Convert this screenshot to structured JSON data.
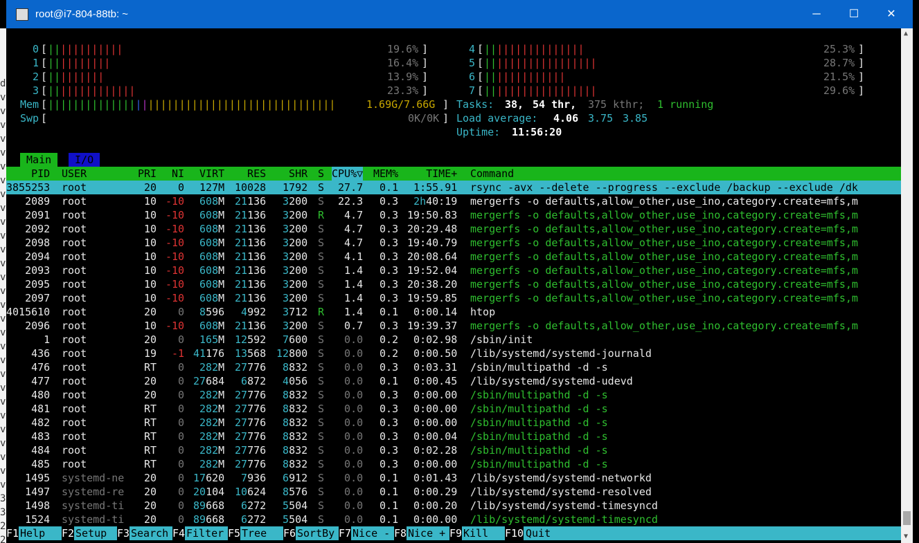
{
  "window": {
    "title": "root@i7-804-88tb: ~"
  },
  "left_strip": [
    "d",
    "v",
    "v",
    "v",
    "v",
    "v",
    "v",
    "v",
    "v",
    "v",
    "v",
    "v",
    "v",
    "v",
    "v",
    "v",
    "v",
    "v",
    "v",
    "v",
    "v",
    "v",
    "v",
    "v",
    "v",
    "v",
    "v",
    "v",
    "v",
    "v",
    "3",
    "3",
    "2",
    "2",
    "2"
  ],
  "cpus": [
    {
      "id": "0",
      "pct": "19.6%",
      "bars": 12
    },
    {
      "id": "1",
      "pct": "16.4%",
      "bars": 10
    },
    {
      "id": "2",
      "pct": "13.9%",
      "bars": 9
    },
    {
      "id": "3",
      "pct": "23.3%",
      "bars": 14
    },
    {
      "id": "4",
      "pct": "25.3%",
      "bars": 16
    },
    {
      "id": "5",
      "pct": "28.7%",
      "bars": 18
    },
    {
      "id": "6",
      "pct": "21.5%",
      "bars": 13
    },
    {
      "id": "7",
      "pct": "29.6%",
      "bars": 18
    }
  ],
  "mem": {
    "label": "Mem",
    "value": "1.69G/7.66G"
  },
  "swp": {
    "label": "Swp",
    "value": "0K/0K"
  },
  "tasks": {
    "label": "Tasks:",
    "count": "38,",
    "thr": "54 thr,",
    "kthr": "375 kthr;",
    "running": "1 running"
  },
  "load": {
    "label": "Load average:",
    "v1": "4.06",
    "v2": "3.75",
    "v3": "3.85"
  },
  "uptime": {
    "label": "Uptime:",
    "value": "11:56:20"
  },
  "tabs": [
    "Main",
    "I/O"
  ],
  "columns": [
    "PID",
    "USER",
    "PRI",
    "NI",
    "VIRT",
    "RES",
    "SHR",
    "S",
    "CPU%▽",
    "MEM%",
    "TIME+",
    "Command"
  ],
  "processes": [
    {
      "pid": "3855253",
      "user": "root",
      "pri": "20",
      "ni": "0",
      "virt": "127M",
      "res": "10028",
      "shr": "1792",
      "s": "S",
      "cpu": "27.7",
      "mem": "0.1",
      "time": "1:55.91",
      "cmd": "rsync -avx --delete --progress --exclude /backup --exclude /dk",
      "selected": true
    },
    {
      "pid": "2089",
      "user": "root",
      "pri": "10",
      "ni": "-10",
      "virt": "608M",
      "res": "21136",
      "shr": "3200",
      "s": "S",
      "cpu": "22.3",
      "mem": "0.3",
      "time": "2h40:19",
      "cmd": "mergerfs -o defaults,allow_other,use_ino,category.create=mfs,m",
      "thread": false
    },
    {
      "pid": "2091",
      "user": "root",
      "pri": "10",
      "ni": "-10",
      "virt": "608M",
      "res": "21136",
      "shr": "3200",
      "s": "R",
      "cpu": "4.7",
      "mem": "0.3",
      "time": "19:50.83",
      "cmd": "mergerfs -o defaults,allow_other,use_ino,category.create=mfs,m",
      "thread": true
    },
    {
      "pid": "2092",
      "user": "root",
      "pri": "10",
      "ni": "-10",
      "virt": "608M",
      "res": "21136",
      "shr": "3200",
      "s": "S",
      "cpu": "4.7",
      "mem": "0.3",
      "time": "20:29.48",
      "cmd": "mergerfs -o defaults,allow_other,use_ino,category.create=mfs,m",
      "thread": true
    },
    {
      "pid": "2098",
      "user": "root",
      "pri": "10",
      "ni": "-10",
      "virt": "608M",
      "res": "21136",
      "shr": "3200",
      "s": "S",
      "cpu": "4.7",
      "mem": "0.3",
      "time": "19:40.79",
      "cmd": "mergerfs -o defaults,allow_other,use_ino,category.create=mfs,m",
      "thread": true
    },
    {
      "pid": "2094",
      "user": "root",
      "pri": "10",
      "ni": "-10",
      "virt": "608M",
      "res": "21136",
      "shr": "3200",
      "s": "S",
      "cpu": "4.1",
      "mem": "0.3",
      "time": "20:08.64",
      "cmd": "mergerfs -o defaults,allow_other,use_ino,category.create=mfs,m",
      "thread": true
    },
    {
      "pid": "2093",
      "user": "root",
      "pri": "10",
      "ni": "-10",
      "virt": "608M",
      "res": "21136",
      "shr": "3200",
      "s": "S",
      "cpu": "1.4",
      "mem": "0.3",
      "time": "19:52.04",
      "cmd": "mergerfs -o defaults,allow_other,use_ino,category.create=mfs,m",
      "thread": true
    },
    {
      "pid": "2095",
      "user": "root",
      "pri": "10",
      "ni": "-10",
      "virt": "608M",
      "res": "21136",
      "shr": "3200",
      "s": "S",
      "cpu": "1.4",
      "mem": "0.3",
      "time": "20:38.20",
      "cmd": "mergerfs -o defaults,allow_other,use_ino,category.create=mfs,m",
      "thread": true
    },
    {
      "pid": "2097",
      "user": "root",
      "pri": "10",
      "ni": "-10",
      "virt": "608M",
      "res": "21136",
      "shr": "3200",
      "s": "S",
      "cpu": "1.4",
      "mem": "0.3",
      "time": "19:59.85",
      "cmd": "mergerfs -o defaults,allow_other,use_ino,category.create=mfs,m",
      "thread": true
    },
    {
      "pid": "4015610",
      "user": "root",
      "pri": "20",
      "ni": "0",
      "virt": "8596",
      "res": "4992",
      "shr": "3712",
      "s": "R",
      "cpu": "1.4",
      "mem": "0.1",
      "time": "0:00.14",
      "cmd": "htop",
      "thread": false
    },
    {
      "pid": "2096",
      "user": "root",
      "pri": "10",
      "ni": "-10",
      "virt": "608M",
      "res": "21136",
      "shr": "3200",
      "s": "S",
      "cpu": "0.7",
      "mem": "0.3",
      "time": "19:39.37",
      "cmd": "mergerfs -o defaults,allow_other,use_ino,category.create=mfs,m",
      "thread": true
    },
    {
      "pid": "1",
      "user": "root",
      "pri": "20",
      "ni": "0",
      "virt": "165M",
      "res": "12592",
      "shr": "7600",
      "s": "S",
      "cpu": "0.0",
      "mem": "0.2",
      "time": "0:02.98",
      "cmd": "/sbin/init",
      "thread": false
    },
    {
      "pid": "436",
      "user": "root",
      "pri": "19",
      "ni": "-1",
      "virt": "41176",
      "res": "13568",
      "shr": "12800",
      "s": "S",
      "cpu": "0.0",
      "mem": "0.2",
      "time": "0:00.50",
      "cmd": "/lib/systemd/systemd-journald",
      "thread": false
    },
    {
      "pid": "476",
      "user": "root",
      "pri": "RT",
      "ni": "0",
      "virt": "282M",
      "res": "27776",
      "shr": "8832",
      "s": "S",
      "cpu": "0.0",
      "mem": "0.3",
      "time": "0:03.31",
      "cmd": "/sbin/multipathd -d -s",
      "thread": false
    },
    {
      "pid": "477",
      "user": "root",
      "pri": "20",
      "ni": "0",
      "virt": "27684",
      "res": "6872",
      "shr": "4056",
      "s": "S",
      "cpu": "0.0",
      "mem": "0.1",
      "time": "0:00.45",
      "cmd": "/lib/systemd/systemd-udevd",
      "thread": false
    },
    {
      "pid": "480",
      "user": "root",
      "pri": "20",
      "ni": "0",
      "virt": "282M",
      "res": "27776",
      "shr": "8832",
      "s": "S",
      "cpu": "0.0",
      "mem": "0.3",
      "time": "0:00.00",
      "cmd": "/sbin/multipathd -d -s",
      "thread": true
    },
    {
      "pid": "481",
      "user": "root",
      "pri": "RT",
      "ni": "0",
      "virt": "282M",
      "res": "27776",
      "shr": "8832",
      "s": "S",
      "cpu": "0.0",
      "mem": "0.3",
      "time": "0:00.00",
      "cmd": "/sbin/multipathd -d -s",
      "thread": true
    },
    {
      "pid": "482",
      "user": "root",
      "pri": "RT",
      "ni": "0",
      "virt": "282M",
      "res": "27776",
      "shr": "8832",
      "s": "S",
      "cpu": "0.0",
      "mem": "0.3",
      "time": "0:00.00",
      "cmd": "/sbin/multipathd -d -s",
      "thread": true
    },
    {
      "pid": "483",
      "user": "root",
      "pri": "RT",
      "ni": "0",
      "virt": "282M",
      "res": "27776",
      "shr": "8832",
      "s": "S",
      "cpu": "0.0",
      "mem": "0.3",
      "time": "0:00.04",
      "cmd": "/sbin/multipathd -d -s",
      "thread": true
    },
    {
      "pid": "484",
      "user": "root",
      "pri": "RT",
      "ni": "0",
      "virt": "282M",
      "res": "27776",
      "shr": "8832",
      "s": "S",
      "cpu": "0.0",
      "mem": "0.3",
      "time": "0:02.28",
      "cmd": "/sbin/multipathd -d -s",
      "thread": true
    },
    {
      "pid": "485",
      "user": "root",
      "pri": "RT",
      "ni": "0",
      "virt": "282M",
      "res": "27776",
      "shr": "8832",
      "s": "S",
      "cpu": "0.0",
      "mem": "0.3",
      "time": "0:00.00",
      "cmd": "/sbin/multipathd -d -s",
      "thread": true
    },
    {
      "pid": "1495",
      "user": "systemd-ne",
      "pri": "20",
      "ni": "0",
      "virt": "17620",
      "res": "7936",
      "shr": "6912",
      "s": "S",
      "cpu": "0.0",
      "mem": "0.1",
      "time": "0:01.43",
      "cmd": "/lib/systemd/systemd-networkd",
      "thread": false
    },
    {
      "pid": "1497",
      "user": "systemd-re",
      "pri": "20",
      "ni": "0",
      "virt": "20104",
      "res": "10624",
      "shr": "8576",
      "s": "S",
      "cpu": "0.0",
      "mem": "0.1",
      "time": "0:00.29",
      "cmd": "/lib/systemd/systemd-resolved",
      "thread": false
    },
    {
      "pid": "1498",
      "user": "systemd-ti",
      "pri": "20",
      "ni": "0",
      "virt": "89668",
      "res": "6272",
      "shr": "5504",
      "s": "S",
      "cpu": "0.0",
      "mem": "0.1",
      "time": "0:00.20",
      "cmd": "/lib/systemd/systemd-timesyncd",
      "thread": false
    },
    {
      "pid": "1524",
      "user": "systemd-ti",
      "pri": "20",
      "ni": "0",
      "virt": "89668",
      "res": "6272",
      "shr": "5504",
      "s": "S",
      "cpu": "0.0",
      "mem": "0.1",
      "time": "0:00.00",
      "cmd": "/lib/systemd/systemd-timesyncd",
      "thread": true
    }
  ],
  "function_keys": [
    {
      "key": "F1",
      "label": "Help  "
    },
    {
      "key": "F2",
      "label": "Setup "
    },
    {
      "key": "F3",
      "label": "Search"
    },
    {
      "key": "F4",
      "label": "Filter"
    },
    {
      "key": "F5",
      "label": "Tree  "
    },
    {
      "key": "F6",
      "label": "SortBy"
    },
    {
      "key": "F7",
      "label": "Nice -"
    },
    {
      "key": "F8",
      "label": "Nice +"
    },
    {
      "key": "F9",
      "label": "Kill  "
    },
    {
      "key": "F10",
      "label": "Quit"
    }
  ]
}
